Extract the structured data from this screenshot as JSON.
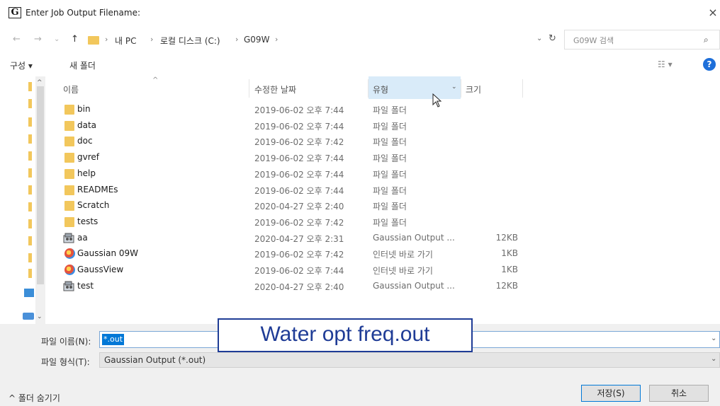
{
  "window": {
    "title": "Enter Job Output Filename:",
    "app_icon_glyph": "G",
    "close_glyph": "×"
  },
  "address": {
    "back_glyph": "←",
    "forward_glyph": "→",
    "recent_glyph": "⌄",
    "up_glyph": "↑",
    "breadcrumb": [
      "내 PC",
      "로컬 디스크 (C:)",
      "G09W"
    ],
    "sep": "›",
    "dropdown_glyph": "⌄",
    "refresh_glyph": "↻",
    "search_placeholder": "G09W 검색",
    "search_glyph": "⌕"
  },
  "toolbar": {
    "organize": "구성 ▾",
    "new_folder": "새 폴더",
    "view_glyph": "☷ ▾",
    "help_glyph": "?"
  },
  "columns": {
    "name": "이름",
    "date": "수정한 날짜",
    "type": "유형",
    "size": "크기",
    "sort_glyph": "^",
    "dropdown_glyph": "⌄"
  },
  "files": [
    {
      "name": "bin",
      "date": "2019-06-02 오후 7:44",
      "type": "파일 폴더",
      "size": "",
      "kind": "folder"
    },
    {
      "name": "data",
      "date": "2019-06-02 오후 7:44",
      "type": "파일 폴더",
      "size": "",
      "kind": "folder"
    },
    {
      "name": "doc",
      "date": "2019-06-02 오후 7:42",
      "type": "파일 폴더",
      "size": "",
      "kind": "folder"
    },
    {
      "name": "gvref",
      "date": "2019-06-02 오후 7:44",
      "type": "파일 폴더",
      "size": "",
      "kind": "folder"
    },
    {
      "name": "help",
      "date": "2019-06-02 오후 7:44",
      "type": "파일 폴더",
      "size": "",
      "kind": "folder"
    },
    {
      "name": "READMEs",
      "date": "2019-06-02 오후 7:44",
      "type": "파일 폴더",
      "size": "",
      "kind": "folder"
    },
    {
      "name": "Scratch",
      "date": "2020-04-27 오후 2:40",
      "type": "파일 폴더",
      "size": "",
      "kind": "folder"
    },
    {
      "name": "tests",
      "date": "2019-06-02 오후 7:42",
      "type": "파일 폴더",
      "size": "",
      "kind": "folder"
    },
    {
      "name": "aa",
      "date": "2020-04-27 오후 2:31",
      "type": "Gaussian Output ...",
      "size": "12KB",
      "kind": "file"
    },
    {
      "name": "Gaussian 09W",
      "date": "2019-06-02 오후 7:42",
      "type": "인터넷 바로 가기",
      "size": "1KB",
      "kind": "link"
    },
    {
      "name": "GaussView",
      "date": "2019-06-02 오후 7:44",
      "type": "인터넷 바로 가기",
      "size": "1KB",
      "kind": "link"
    },
    {
      "name": "test",
      "date": "2020-04-27 오후 2:40",
      "type": "Gaussian Output ...",
      "size": "12KB",
      "kind": "file"
    }
  ],
  "nav": {
    "up_glyph": "^",
    "down_glyph": "⌄"
  },
  "bottom": {
    "filename_label": "파일 이름(N):",
    "filename_value": "*.out",
    "filetype_label": "파일 형식(T):",
    "filetype_value": "Gaussian Output (*.out)",
    "dropdown_glyph": "⌄",
    "hide_folders": "^ 폴더 숨기기",
    "save": "저장(S)",
    "cancel": "취소"
  },
  "overlay": {
    "text": "Water opt freq.out"
  },
  "colors": {
    "accent": "#0078d7",
    "folder": "#f2c75c",
    "overlay": "#1f3c96",
    "type_column_highlight": "#d9ebf9"
  }
}
